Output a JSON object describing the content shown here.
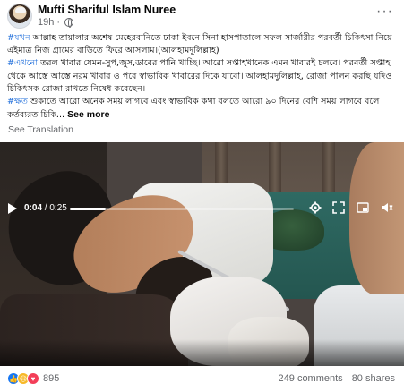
{
  "post": {
    "author": "Mufti Shariful Islam Nuree",
    "time": "19h",
    "audience_icon": "globe-icon",
    "more_icon": "more-horizontal-icon",
    "paragraphs": [
      {
        "hashtag": "#যখন",
        "text": " আল্লাহ তায়ালার অশেষ মেহেরবানিতে ঢাকা ইবনে সিনা হাসপাতালে সফল সার্জারীর পরবর্তী চিকিৎসা নিয়ে এইমাত্র নিজ গ্রামের বাড়িতে ফিরে আসলাম।(আলহামদুলিল্লাহ)"
      },
      {
        "hashtag": "#এখনো",
        "text": " তরল খাবার যেমন-সুপ,জুস,ডাবের পানি খাচ্ছি। আরো সপ্তাহখানেক এমন খাবারই চলবে। পরবর্তী সপ্তাহ থেকে আস্তে আস্তে নরম খাবার ও পরে স্বাভাবিক খাবারের দিকে যাবো। আলহামদুলিল্লাহ, রোজা পালন করছি যদিও চিকিৎসক রোজা রাখতে নিষেধ করেছেন।"
      },
      {
        "hashtag": "#ক্ষত",
        "text": " শুকাতে আরো অনেক সময় লাগবে এবং স্বাভাবিক কথা বলতে আরো ৯০ দিনের বেশি সময় লাগবে বলে কর্তব্যরত চিকি..."
      }
    ],
    "see_more": "See more",
    "see_translation": "See Translation"
  },
  "video": {
    "current_time": "0:04",
    "duration": "0:25",
    "progress_fraction": 0.16,
    "controls": {
      "play_icon": "play-icon",
      "settings_icon": "settings-icon",
      "fullscreen_icon": "fullscreen-icon",
      "pip_icon": "picture-in-picture-icon",
      "volume_icon": "volume-icon"
    }
  },
  "footer": {
    "reaction_icons": [
      "like-icon",
      "sad-icon",
      "love-icon"
    ],
    "reaction_count": "895",
    "comments": "249 comments",
    "shares": "80 shares"
  },
  "colors": {
    "hashtag": "#216fdb",
    "secondary_text": "#65676b",
    "like": "#1877f2",
    "love": "#f33e58",
    "sad": "#f7b928"
  }
}
